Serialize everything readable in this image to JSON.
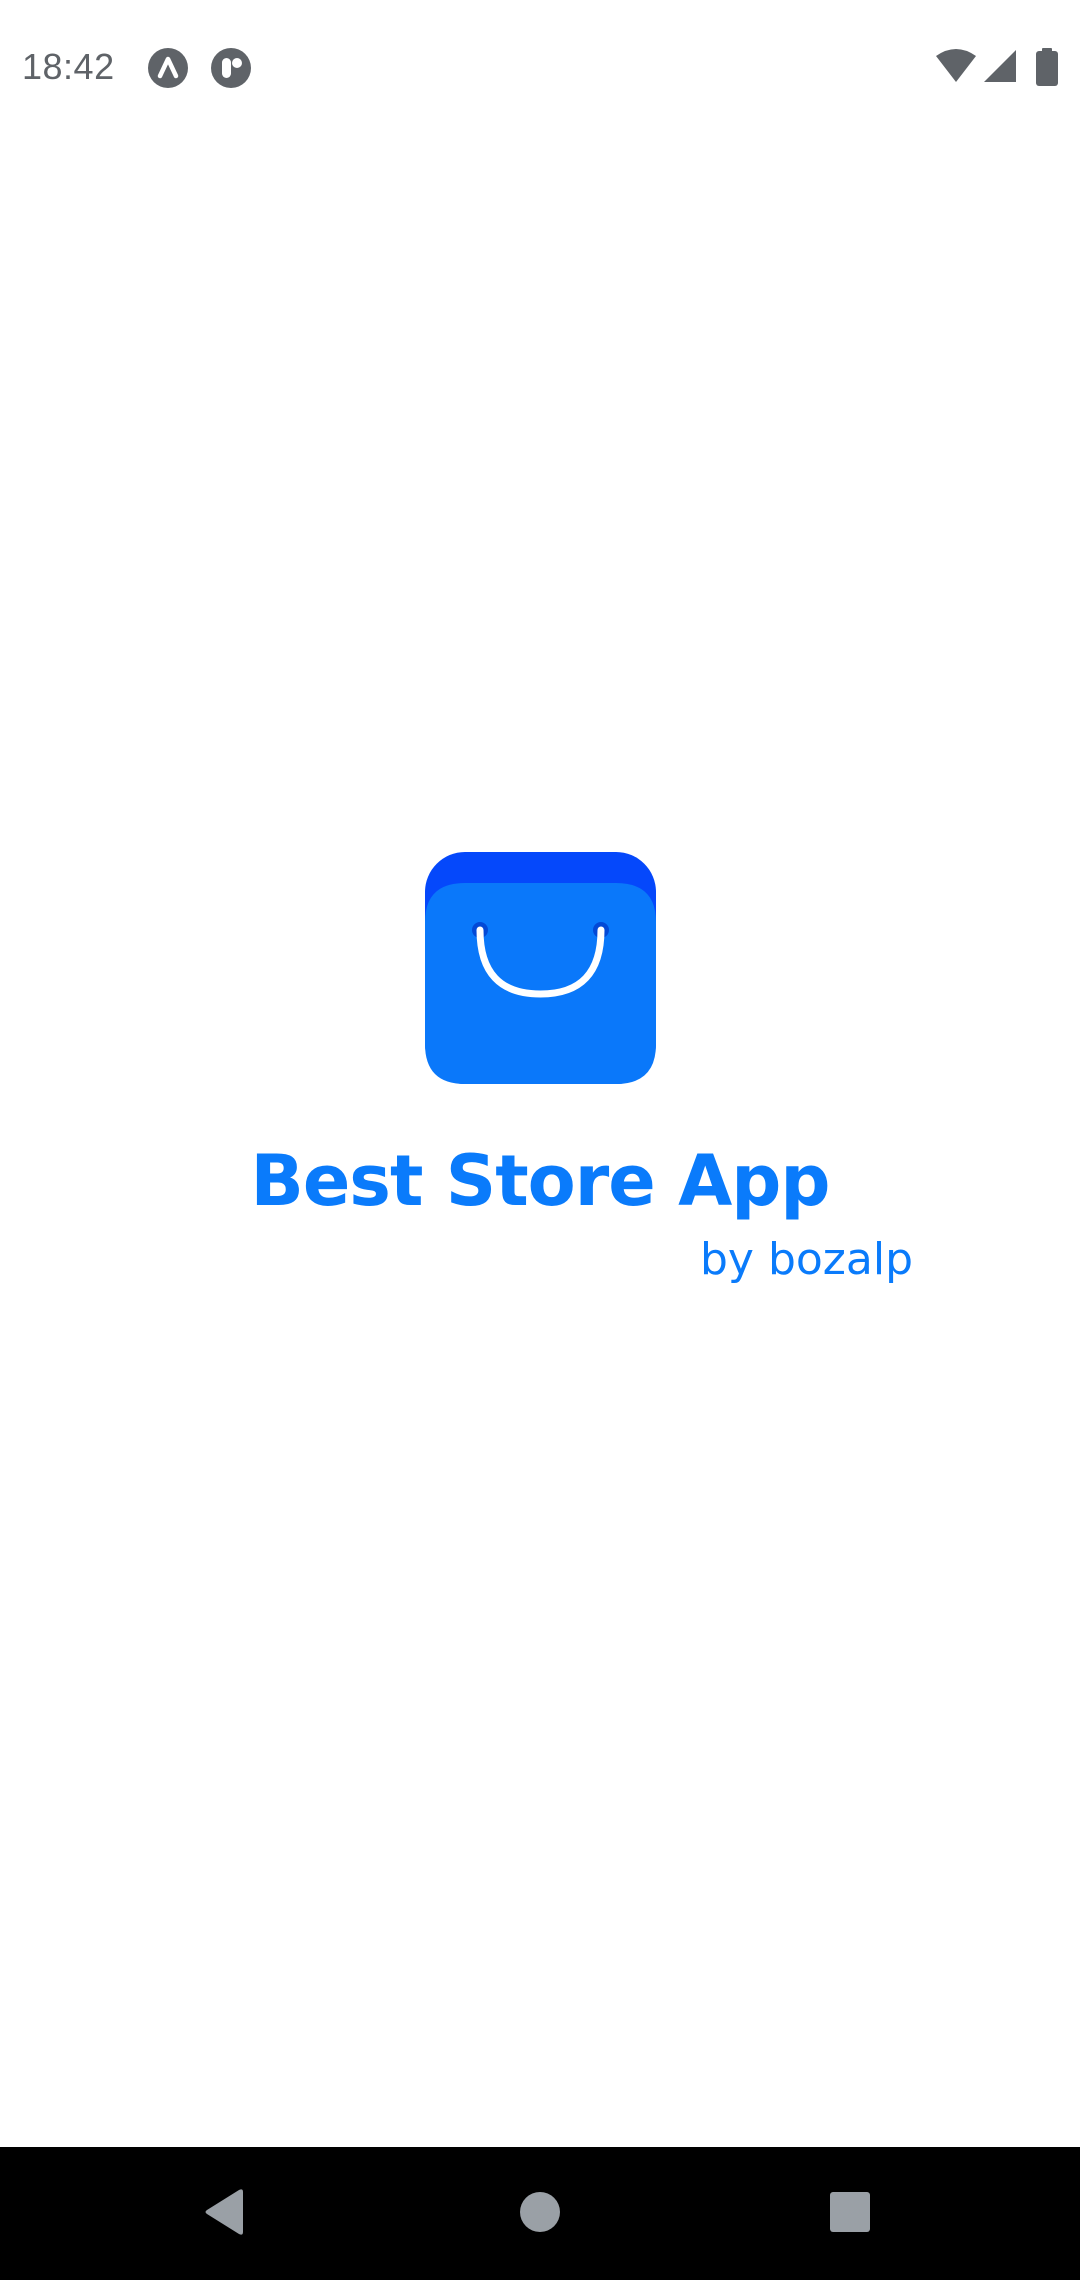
{
  "status_bar": {
    "time": "18:42",
    "left_icons": [
      "notification-a-icon",
      "notification-app-icon"
    ],
    "right_icons": [
      "wifi-icon",
      "signal-icon",
      "battery-icon"
    ],
    "icon_color": "#5f6368"
  },
  "splash": {
    "logo_icon": "shopping-bag-icon",
    "title": "Best Store App",
    "byline": "by bozalp",
    "accent_color": "#0a7bfb",
    "logo_top_color": "#0548fb",
    "logo_body_color": "#0a78fa"
  },
  "nav_bar": {
    "buttons": [
      "back-icon",
      "home-icon",
      "recents-icon"
    ],
    "background": "#000000",
    "icon_color": "#9aa0a6"
  }
}
